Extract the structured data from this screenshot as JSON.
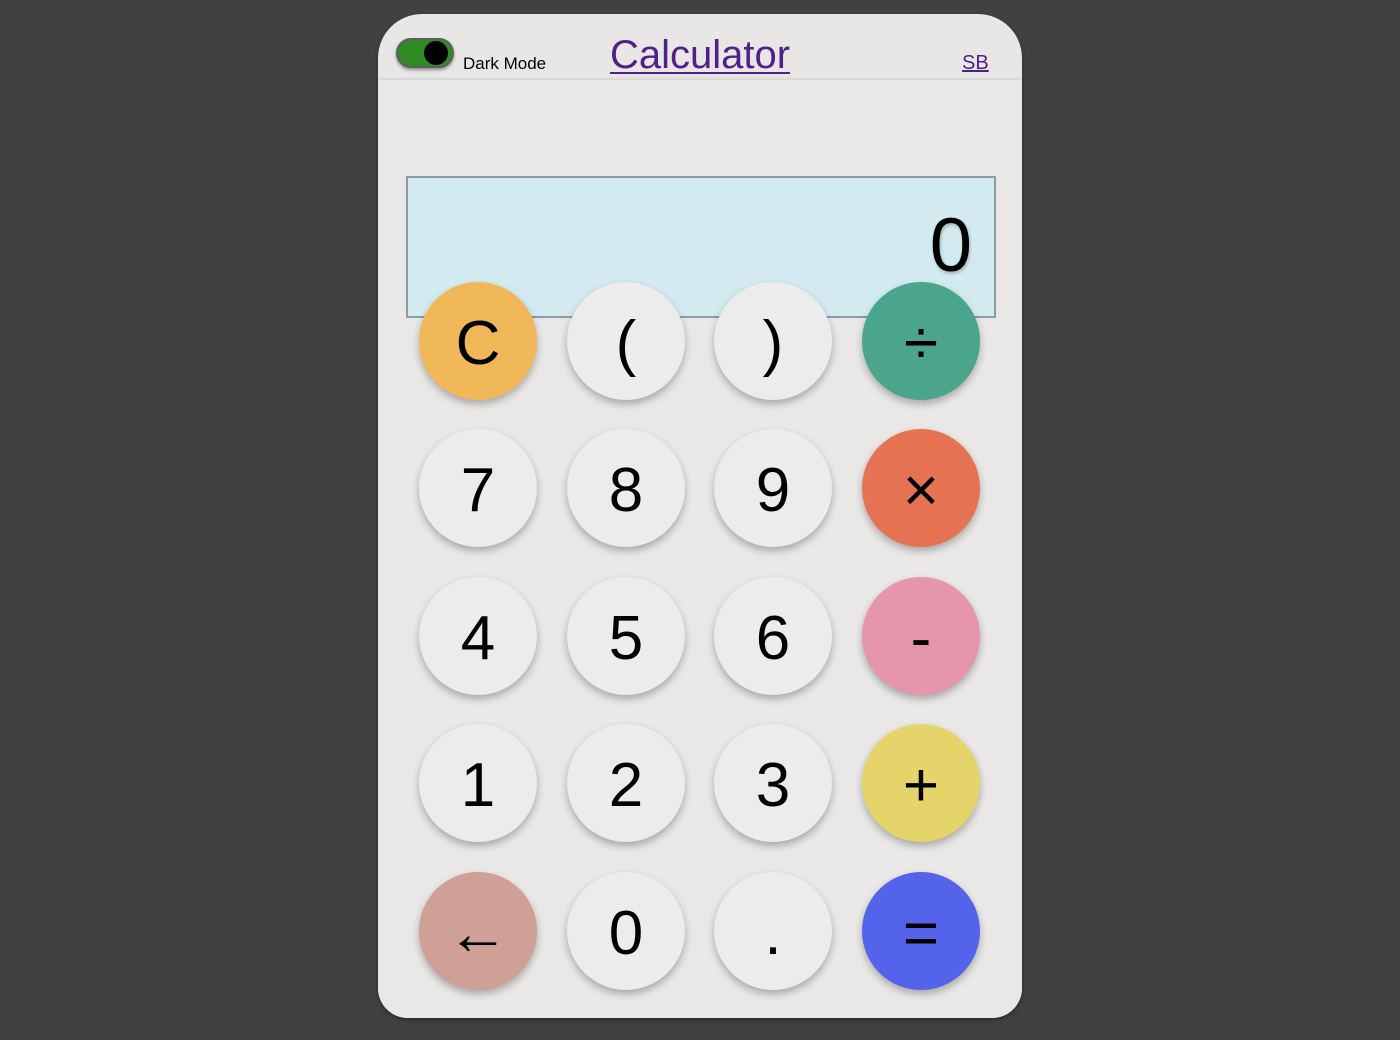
{
  "header": {
    "dark_mode_label": "Dark Mode",
    "dark_mode_on": true,
    "title": "Calculator",
    "author_link": "SB"
  },
  "display": {
    "value": "0"
  },
  "colors": {
    "background": "#414141",
    "clear": "#f1b85a",
    "divide": "#4aa58a",
    "multiply": "#e57253",
    "subtract": "#e596ad",
    "add": "#e5d46a",
    "backspace": "#cfa095",
    "equals": "#5464ea",
    "default": "#ececec",
    "toggle_on": "#2f8a24",
    "link": "#4f1f8a"
  },
  "keypad": {
    "rows": [
      [
        {
          "label": "C",
          "name": "clear-button",
          "color": "clear"
        },
        {
          "label": "(",
          "name": "open-paren-button",
          "color": "default"
        },
        {
          "label": ")",
          "name": "close-paren-button",
          "color": "default"
        },
        {
          "label": "÷",
          "name": "divide-button",
          "color": "divide"
        }
      ],
      [
        {
          "label": "7",
          "name": "digit-7-button",
          "color": "default"
        },
        {
          "label": "8",
          "name": "digit-8-button",
          "color": "default"
        },
        {
          "label": "9",
          "name": "digit-9-button",
          "color": "default"
        },
        {
          "label": "×",
          "name": "multiply-button",
          "color": "multiply"
        }
      ],
      [
        {
          "label": "4",
          "name": "digit-4-button",
          "color": "default"
        },
        {
          "label": "5",
          "name": "digit-5-button",
          "color": "default"
        },
        {
          "label": "6",
          "name": "digit-6-button",
          "color": "default"
        },
        {
          "label": "-",
          "name": "subtract-button",
          "color": "subtract"
        }
      ],
      [
        {
          "label": "1",
          "name": "digit-1-button",
          "color": "default"
        },
        {
          "label": "2",
          "name": "digit-2-button",
          "color": "default"
        },
        {
          "label": "3",
          "name": "digit-3-button",
          "color": "default"
        },
        {
          "label": "+",
          "name": "add-button",
          "color": "add"
        }
      ],
      [
        {
          "label": "←",
          "name": "backspace-button",
          "color": "backspace"
        },
        {
          "label": "0",
          "name": "digit-0-button",
          "color": "default"
        },
        {
          "label": ".",
          "name": "decimal-button",
          "color": "default"
        },
        {
          "label": "=",
          "name": "equals-button",
          "color": "equals"
        }
      ]
    ]
  }
}
